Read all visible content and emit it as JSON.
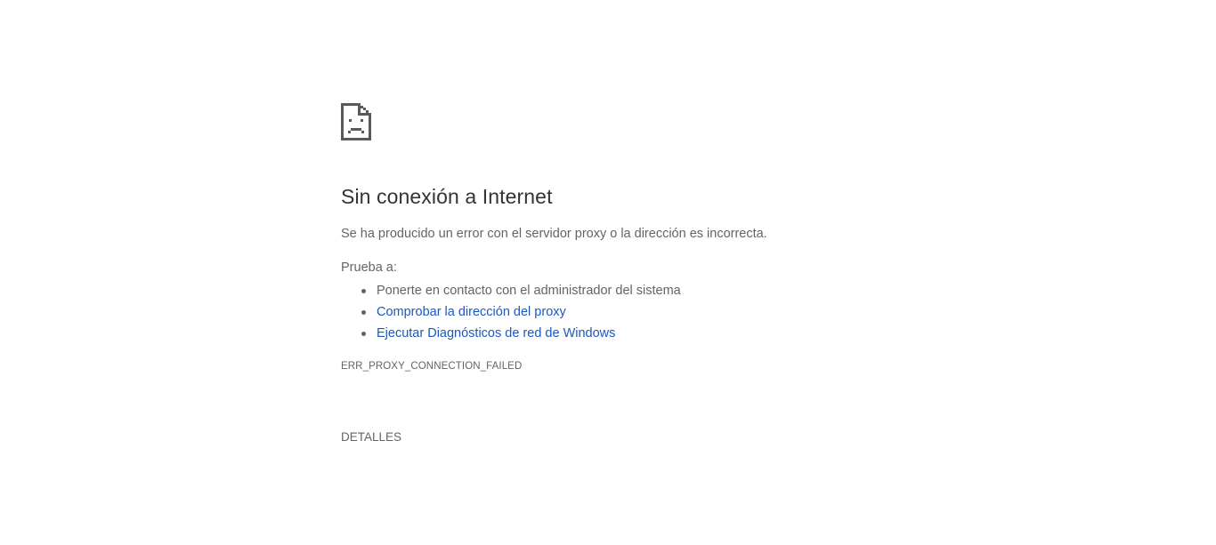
{
  "icon": "sad-document-icon",
  "error": {
    "title": "Sin conexión a Internet",
    "description": "Se ha producido un error con el servidor proxy o la dirección es incorrecta.",
    "suggestions_heading": "Prueba a:",
    "suggestions": [
      {
        "label": "Ponerte en contacto con el administrador del sistema",
        "link": false
      },
      {
        "label": "Comprobar la dirección del proxy",
        "link": true
      },
      {
        "label": "Ejecutar Diagnósticos de red de Windows",
        "link": true
      }
    ],
    "code": "ERR_PROXY_CONNECTION_FAILED"
  },
  "details_button": "DETALLES",
  "colors": {
    "link": "#1a58c2",
    "title": "#333333",
    "text": "#646464",
    "icon": "#5a5a5a"
  }
}
